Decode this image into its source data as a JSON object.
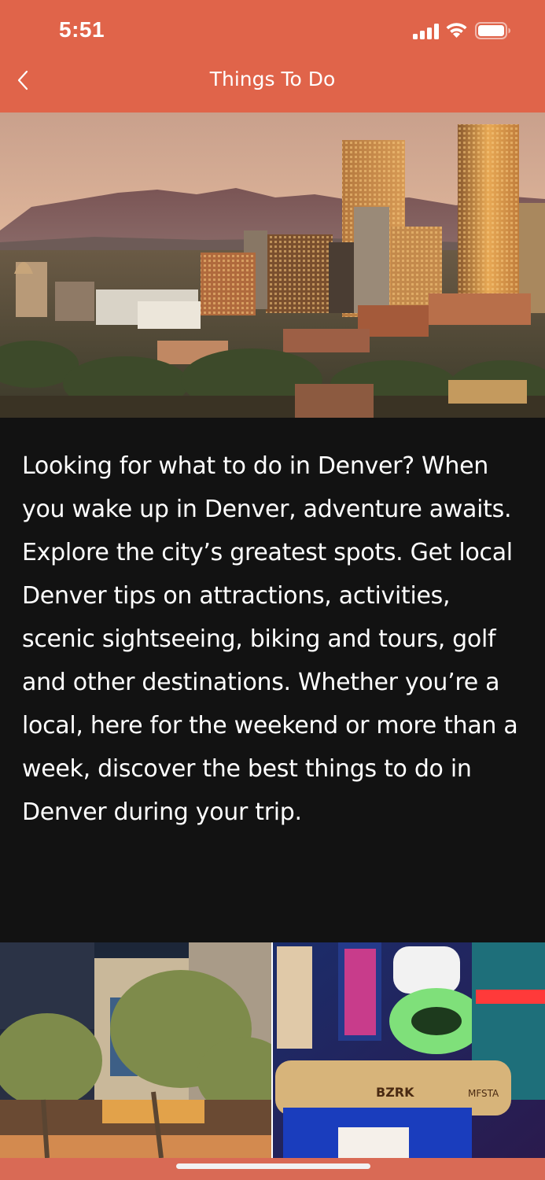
{
  "status_bar": {
    "time": "5:51"
  },
  "nav": {
    "title": "Things To Do"
  },
  "hero": {
    "alt": "Denver skyline at sunset with mountains"
  },
  "description": {
    "text": "Looking for what to do in Denver? When you wake up in Denver, adventure awaits. Explore the city’s greatest spots. Get local Denver tips on attractions, activities, scenic sightseeing, biking and tours, golf and other destinations. Whether you’re a local, here for the weekend or more than a week, discover the best things to do in Denver during your trip."
  },
  "gallery": {
    "left": {
      "caption": ""
    },
    "right": {
      "sign_text": "BZRK",
      "sign_text_2": "MFSTA"
    }
  },
  "colors": {
    "header_bg": "#e0644a",
    "body_bg": "#121212",
    "text": "#ffffff"
  }
}
